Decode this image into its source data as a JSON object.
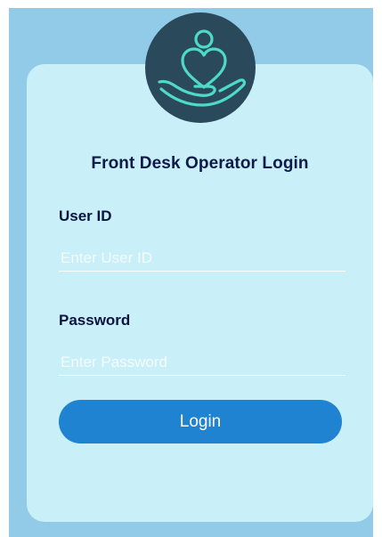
{
  "page": {
    "heading": "Front Desk Operator Login"
  },
  "logo": {
    "icon": "care-hand-heart-icon",
    "colors": {
      "background": "#2a4a5c",
      "stroke": "#4fd9c8"
    }
  },
  "form": {
    "user_id": {
      "label": "User ID",
      "placeholder": "Enter User ID",
      "value": ""
    },
    "password": {
      "label": "Password",
      "placeholder": "Enter Password",
      "value": ""
    },
    "login_label": "Login"
  },
  "colors": {
    "backdrop": "#92cbe8",
    "card": "#c9eff8",
    "heading_text": "#0d1a4a",
    "button": "#1f83d2",
    "button_text": "#ffffff"
  }
}
